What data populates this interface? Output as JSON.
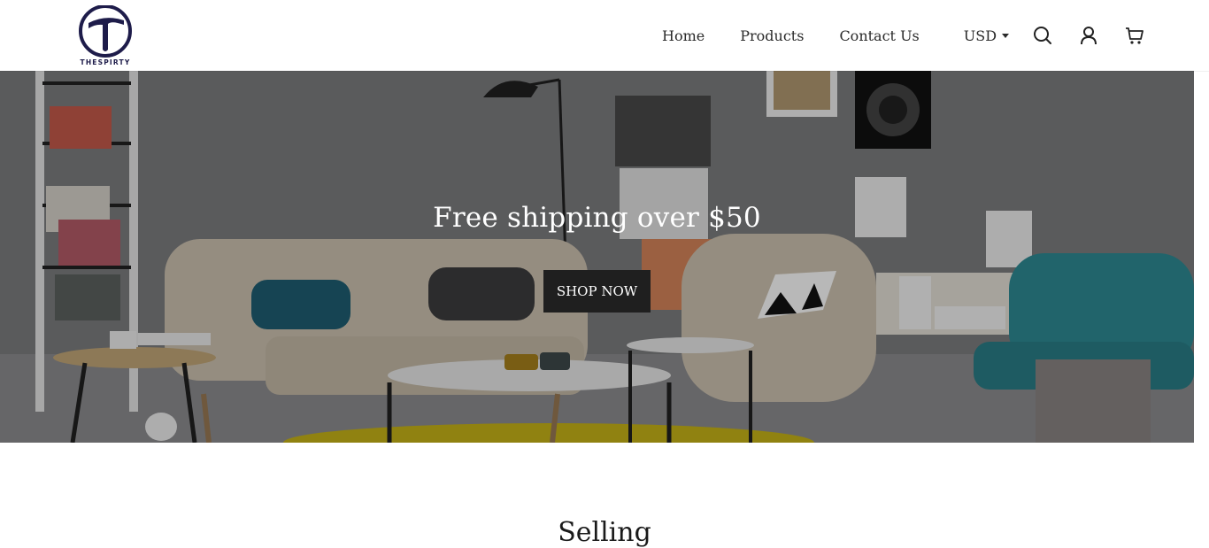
{
  "header": {
    "logo_text": "THESPIRTY",
    "nav": [
      {
        "label": "Home"
      },
      {
        "label": "Products"
      },
      {
        "label": "Contact Us"
      }
    ],
    "currency": "USD",
    "icons": [
      "search-icon",
      "account-icon",
      "cart-icon"
    ]
  },
  "hero": {
    "title": "Free shipping over $50",
    "button_label": "SHOP NOW"
  },
  "section": {
    "title": "Selling"
  },
  "colors": {
    "brand_navy": "#1e1c4a",
    "button_bg": "#1f1f1f",
    "header_bg": "#ffffff"
  }
}
